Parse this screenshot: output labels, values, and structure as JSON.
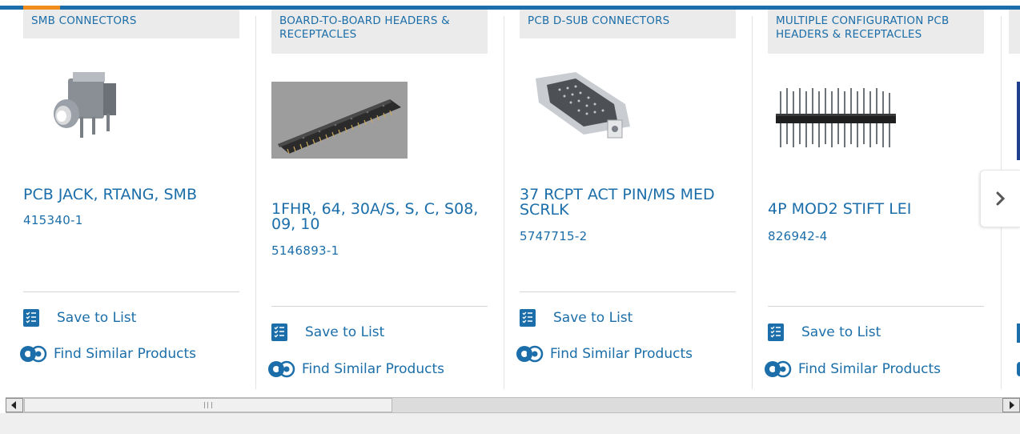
{
  "products": [
    {
      "category": "SMB CONNECTORS",
      "title": "PCB JACK, RTANG, SMB",
      "part_number": "415340-1",
      "image_icon": "smb-connector-image"
    },
    {
      "category": "BOARD-TO-BOARD HEADERS & RECEPTACLES",
      "title": "1FHR, 64, 30A/S, S, C, S08, 09, 10",
      "part_number": "5146893-1",
      "image_icon": "board-header-image"
    },
    {
      "category": "PCB D-SUB CONNECTORS",
      "title": "37 RCPT ACT PIN/MS MED SCRLK",
      "part_number": "5747715-2",
      "image_icon": "dsub-connector-image"
    },
    {
      "category": "MULTIPLE CONFIGURATION PCB HEADERS & RECEPTACLES",
      "title": "4P MOD2 STIFT LEI",
      "part_number": "826942-4",
      "image_icon": "pin-header-image"
    }
  ],
  "actions": {
    "save_label": "Save to List",
    "similar_label": "Find Similar Products"
  },
  "colors": {
    "accent": "#1b6ea9",
    "highlight": "#f28c1a",
    "category_bg": "#ebebeb"
  }
}
